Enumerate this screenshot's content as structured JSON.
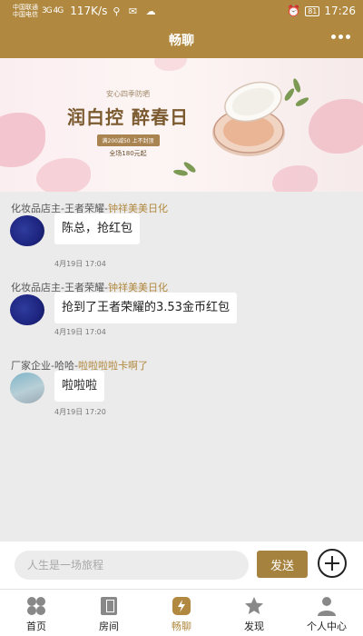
{
  "status_bar": {
    "carrier_1": "中国联通",
    "carrier_2": "中国电信",
    "signal": "3G 4G",
    "speed": "117K/s",
    "battery": "81",
    "time": "17:26"
  },
  "header": {
    "title": "畅聊"
  },
  "banner": {
    "subtitle": "安心四季防晒",
    "slogan": "润白控 醉春日",
    "promo": "满200减50 上不封顶",
    "price_note": "全场180元起"
  },
  "messages": [
    {
      "sender_prefix": "化妆品店主-王者荣耀-",
      "sender_highlight": "钟祥美美日化",
      "text": "陈总，抢红包",
      "time": "4月19日 17:04"
    },
    {
      "sender_prefix": "化妆品店主-王者荣耀-",
      "sender_highlight": "钟祥美美日化",
      "text": "抢到了王者荣耀的3.53金币红包",
      "time": "4月19日 17:04"
    },
    {
      "sender_prefix": "厂家企业-哈哈-",
      "sender_highlight": "啦啦啦啦卡啊了",
      "text": "啦啦啦",
      "time": "4月19日 17:20"
    }
  ],
  "input_bar": {
    "placeholder": "人生是一场旅程",
    "send_label": "发送"
  },
  "tabs": [
    {
      "label": "首页",
      "icon": "home-grid-icon",
      "active": false
    },
    {
      "label": "房间",
      "icon": "room-icon",
      "active": false
    },
    {
      "label": "畅聊",
      "icon": "chat-bolt-icon",
      "active": true
    },
    {
      "label": "发现",
      "icon": "star-icon",
      "active": false
    },
    {
      "label": "个人中心",
      "icon": "person-icon",
      "active": false
    }
  ],
  "colors": {
    "brand": "#b0883f",
    "send": "#a6823f",
    "background": "#ebebeb"
  }
}
